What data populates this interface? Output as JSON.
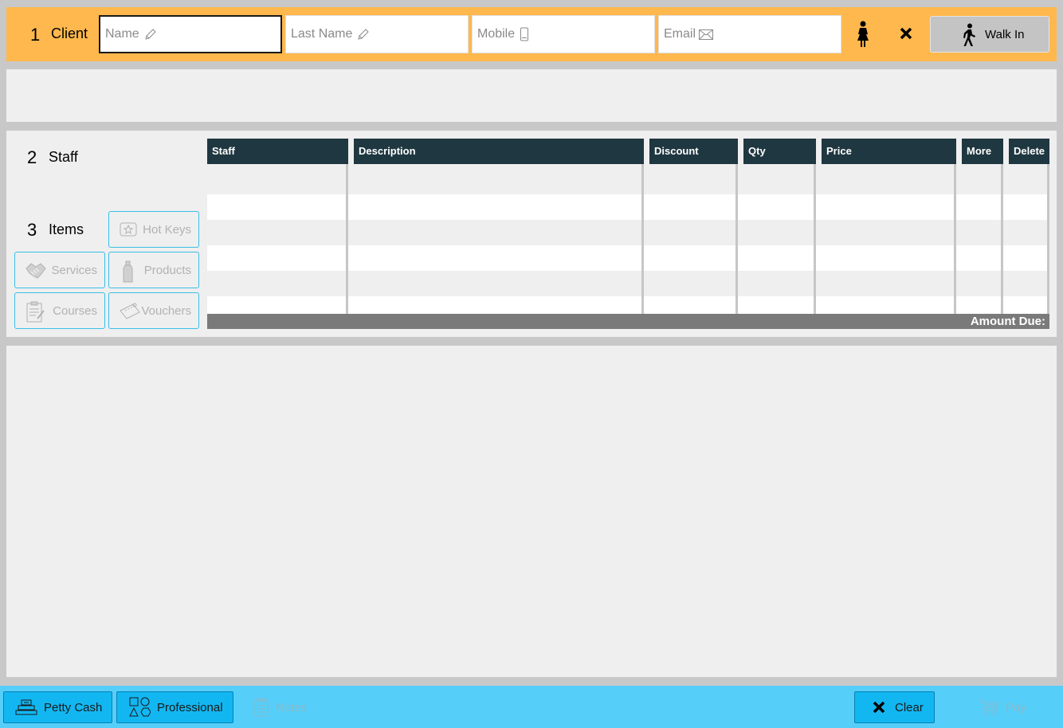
{
  "client": {
    "number": "1",
    "label": "Client",
    "name_placeholder": "Name",
    "lastname_placeholder": "Last Name",
    "mobile_placeholder": "Mobile",
    "email_placeholder": "Email",
    "walkin_label": "Walk In"
  },
  "staff": {
    "number": "2",
    "label": "Staff"
  },
  "items": {
    "number": "3",
    "label": "Items",
    "hotkeys": "Hot Keys",
    "services": "Services",
    "products": "Products",
    "courses": "Courses",
    "vouchers": "Vouchers"
  },
  "table": {
    "columns": [
      "Staff",
      "Description",
      "Discount",
      "Qty",
      "Price",
      "More",
      "Delete"
    ],
    "amount_due_label": "Amount Due:"
  },
  "footer": {
    "petty_cash": "Petty Cash",
    "professional": "Professional",
    "notes": "Notes",
    "clear": "Clear",
    "pay": "Pay"
  },
  "colors": {
    "client_bar": "#ffb84d",
    "table_header": "#1f3740",
    "footer": "#55cffa",
    "footer_button": "#12b7f2",
    "item_button_border": "#39bfe8"
  }
}
